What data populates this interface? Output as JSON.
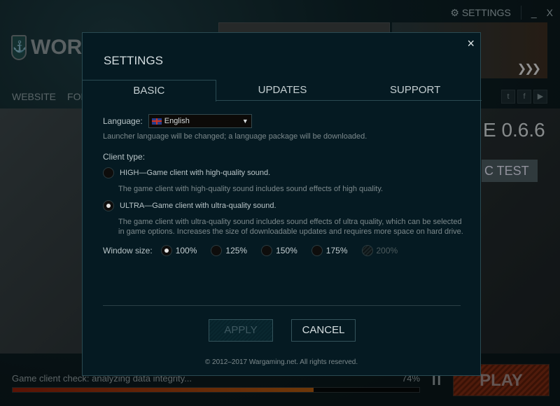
{
  "launcher": {
    "settings_label": "SETTINGS",
    "minimize": "_",
    "close": "X",
    "logo_text": "WOR",
    "nav": [
      "WEBSITE",
      "FORUM"
    ],
    "social": [
      "t",
      "f",
      "▶"
    ],
    "version_fragment": "E 0.6.6",
    "test_fragment": "C TEST",
    "status_text": "Game client check: analyzing data integrity...",
    "progress_label": "74%",
    "progress_percent": 74,
    "pause": "II",
    "play_label": "PLAY"
  },
  "modal": {
    "title": "SETTINGS",
    "close": "×",
    "tabs": [
      {
        "label": "BASIC"
      },
      {
        "label": "UPDATES"
      },
      {
        "label": "SUPPORT"
      }
    ],
    "language": {
      "label": "Language:",
      "value": "English",
      "hint": "Launcher language will be changed; a language package will be downloaded."
    },
    "client_type": {
      "label": "Client type:",
      "options": [
        {
          "label": "HIGH—Game client with high-quality sound.",
          "desc": "The game client with high-quality sound includes sound effects of high quality.",
          "selected": false
        },
        {
          "label": "ULTRA—Game client with ultra-quality sound.",
          "desc": "The game client with ultra-quality sound includes sound effects of ultra quality, which can be selected in game options. Increases the size of downloadable updates and requires more space on hard drive.",
          "selected": true
        }
      ]
    },
    "window_size": {
      "label": "Window size:",
      "options": [
        "100%",
        "125%",
        "150%",
        "175%",
        "200%"
      ],
      "selected": "100%",
      "disabled": [
        "200%"
      ]
    },
    "apply": "APPLY",
    "cancel": "CANCEL",
    "copyright": "© 2012–2017 Wargaming.net. All rights reserved."
  },
  "colors": {
    "background": "#051a22",
    "border": "#2a4a52",
    "progress": "#a8560e",
    "play": "#7a2a12"
  }
}
